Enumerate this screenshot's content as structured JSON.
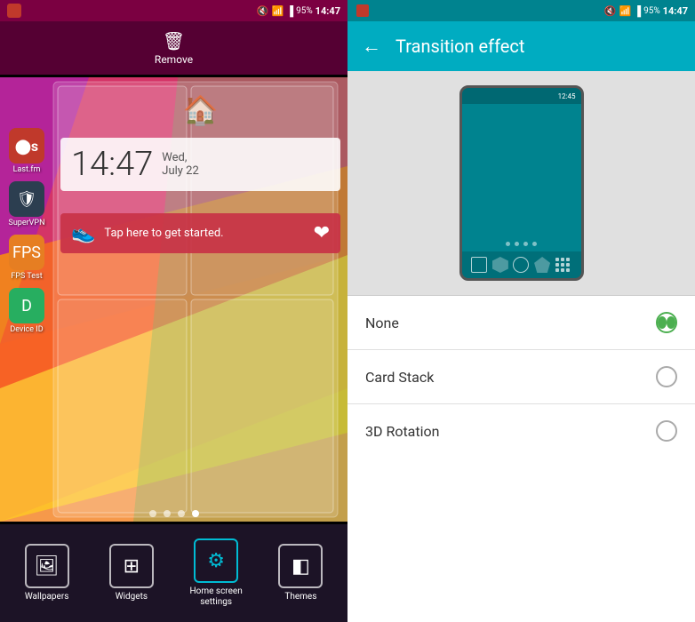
{
  "left": {
    "status_bar": {
      "time": "14:47",
      "battery": "95%",
      "signal": "4"
    },
    "remove_bar": {
      "label": "Remove"
    },
    "widget": {
      "time": "14:47",
      "date": "Wed, July 22",
      "health_text": "Tap here to get started."
    },
    "side_apps": [
      {
        "label": "Last.fm",
        "color": "#c0392b",
        "icon": "♪"
      },
      {
        "label": "SuperVPN",
        "color": "#2c3e50",
        "icon": "🛡"
      },
      {
        "label": "FPS Test",
        "color": "#e67e22",
        "icon": "F"
      },
      {
        "label": "Device ID",
        "color": "#2ecc71",
        "icon": "D"
      }
    ],
    "dots": [
      "",
      "",
      "",
      "active"
    ],
    "nav": [
      {
        "label": "Wallpapers",
        "icon": "🖼"
      },
      {
        "label": "Widgets",
        "icon": "⊞"
      },
      {
        "label": "Home screen settings",
        "icon": "⚙"
      },
      {
        "label": "Themes",
        "icon": "◧"
      }
    ]
  },
  "right": {
    "status_bar": {
      "time": "14:47",
      "battery": "95%"
    },
    "header": {
      "title": "Transition effect",
      "back_label": "←"
    },
    "phone_preview": {
      "status_time": "12:45"
    },
    "options": [
      {
        "label": "None",
        "selected": true
      },
      {
        "label": "Card Stack",
        "selected": false
      },
      {
        "label": "3D Rotation",
        "selected": false
      }
    ]
  }
}
